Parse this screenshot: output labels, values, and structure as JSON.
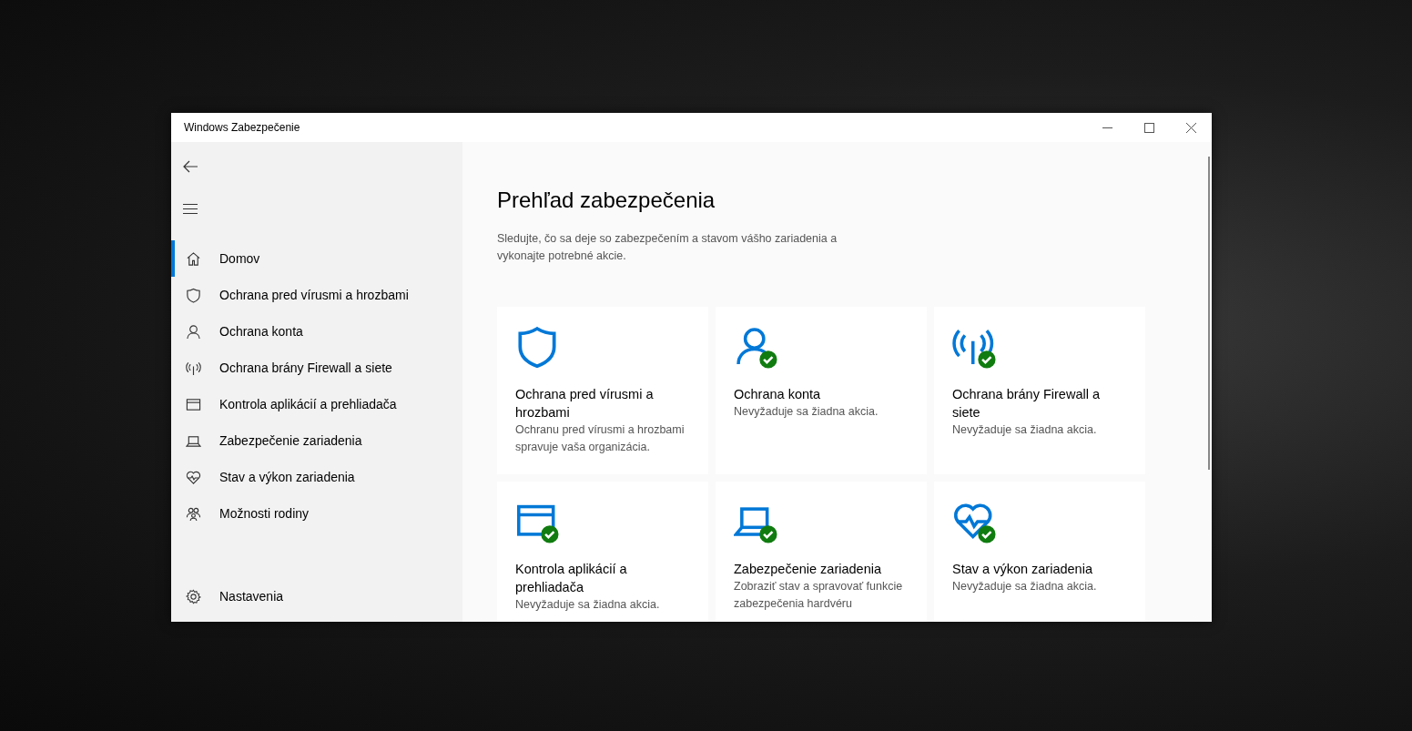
{
  "window": {
    "title": "Windows Zabezpečenie"
  },
  "sidebar": {
    "items": [
      {
        "label": "Domov",
        "selected": true
      },
      {
        "label": "Ochrana pred vírusmi a hrozbami",
        "selected": false
      },
      {
        "label": "Ochrana konta",
        "selected": false
      },
      {
        "label": "Ochrana brány Firewall a siete",
        "selected": false
      },
      {
        "label": "Kontrola aplikácií a prehliadača",
        "selected": false
      },
      {
        "label": "Zabezpečenie zariadenia",
        "selected": false
      },
      {
        "label": "Stav a výkon zariadenia",
        "selected": false
      },
      {
        "label": "Možnosti rodiny",
        "selected": false
      }
    ],
    "settings": {
      "label": "Nastavenia"
    }
  },
  "main": {
    "title": "Prehľad zabezpečenia",
    "description": "Sledujte, čo sa deje so zabezpečením a stavom vášho zariadenia a vykonajte potrebné akcie.",
    "cards": [
      {
        "ok": false,
        "title": "Ochrana pred vírusmi a hrozbami",
        "status": "Ochranu pred vírusmi a hrozbami spravuje vaša organizácia."
      },
      {
        "ok": true,
        "title": "Ochrana konta",
        "status": "Nevyžaduje sa žiadna akcia."
      },
      {
        "ok": true,
        "title": "Ochrana brány Firewall a siete",
        "status": "Nevyžaduje sa žiadna akcia."
      },
      {
        "ok": true,
        "title": "Kontrola aplikácií a prehliadača",
        "status": "Nevyžaduje sa žiadna akcia."
      },
      {
        "ok": true,
        "title": "Zabezpečenie zariadenia",
        "status": "Zobraziť stav a spravovať funkcie zabezpečenia hardvéru"
      },
      {
        "ok": true,
        "title": "Stav a výkon zariadenia",
        "status": "Nevyžaduje sa žiadna akcia."
      }
    ]
  }
}
